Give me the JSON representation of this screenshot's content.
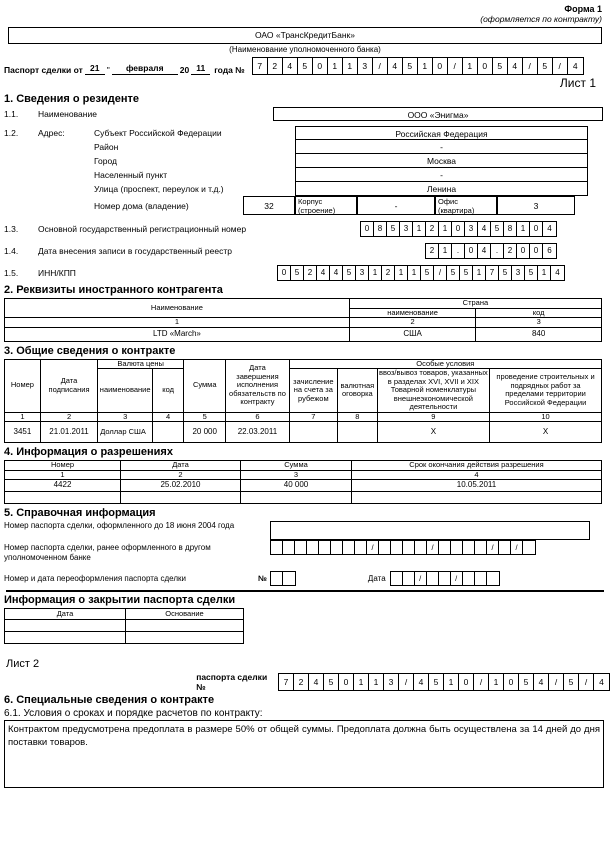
{
  "header": {
    "form_label": "Форма 1",
    "form_note": "(оформляется по контракту)",
    "bank_name": "ОАО «ТрансКредитБанк»",
    "bank_caption": "(Наименование уполномоченного банка)",
    "passport_prefix": "Паспорт сделки от",
    "day": "21",
    "quote": "\"",
    "month": "февраля",
    "year_prefix": "20",
    "year_suffix": "11",
    "year_word": "года №",
    "passport_number": "724501 13/4510/1054/5/4",
    "passport_cells": [
      "7",
      "2",
      "4",
      "5",
      "0",
      "1",
      "1",
      "3",
      "/",
      "4",
      "5",
      "1",
      "0",
      "/",
      "1",
      "0",
      "5",
      "4",
      "/",
      "5",
      "/",
      "4"
    ],
    "sheet_1": "Лист 1"
  },
  "section1": {
    "title": "1. Сведения о резиденте",
    "n11": "1.1.",
    "name_label": "Наименование",
    "name_value": "ООО «Энигма»",
    "n12": "1.2.",
    "address_label": "Адрес:",
    "address_rows": [
      {
        "label": "Субъект Российской Федерации",
        "value": "Российская Федерация"
      },
      {
        "label": "Район",
        "value": "-"
      },
      {
        "label": "Город",
        "value": "Москва"
      },
      {
        "label": "Населенный пункт",
        "value": "-"
      },
      {
        "label": "Улица (проспект, переулок и т.д.)",
        "value": "Ленина"
      }
    ],
    "house_label": "Номер дома (владение)",
    "house_value": "32",
    "building_label": "Корпус (строение)",
    "building_value": "-",
    "office_label": "Офис (квартира)",
    "office_value": "3",
    "n13": "1.3.",
    "ogrn_label": "Основной государственный регистрационный номер",
    "ogrn_cells": [
      "0",
      "8",
      "5",
      "3",
      "1",
      "2",
      "1",
      "0",
      "3",
      "4",
      "5",
      "8",
      "1",
      "0",
      "4"
    ],
    "n14": "1.4.",
    "reg_date_label": "Дата внесения записи в государственный реестр",
    "reg_date_cells": [
      "2",
      "1",
      ".",
      "0",
      "4",
      ".",
      "2",
      "0",
      "0",
      "6"
    ],
    "n15": "1.5.",
    "inn_label": "ИНН/КПП",
    "inn_cells": [
      "0",
      "5",
      "2",
      "4",
      "4",
      "5",
      "3",
      "1",
      "2",
      "1",
      "1",
      "5",
      "/",
      "5",
      "5",
      "1",
      "7",
      "5",
      "3",
      "5",
      "1",
      "4"
    ]
  },
  "section2": {
    "title": "2. Реквизиты иностранного контрагента",
    "headers": {
      "name": "Наименование",
      "country": "Страна",
      "country_name": "наименование",
      "country_code": "код"
    },
    "numbering": [
      "1",
      "2",
      "3"
    ],
    "row": {
      "name": "LTD «March»",
      "country_name": "США",
      "country_code": "840"
    }
  },
  "section3": {
    "title": "3. Общие сведения о контракте",
    "headers": {
      "number": "Номер",
      "sign_date": "Дата подписания",
      "price_currency": "Валюта цены",
      "currency_name": "наименование",
      "currency_code": "код",
      "sum": "Сумма",
      "end_date": "Дата завершения исполнения обязательств по контракту",
      "special_conditions": "Особые условия",
      "abroad_account": "зачисление на счета за рубежом",
      "currency_clause": "валютная оговорка",
      "goods_import": "ввоз/вывоз товаров, указанных в разделах XVI, XVII и XIX Товарной номенклатуры внешнеэкономической деятельности",
      "construction": "проведение строительных и подрядных работ за пределами территории Российской Федерации"
    },
    "numbering": [
      "1",
      "2",
      "3",
      "4",
      "5",
      "6",
      "7",
      "8",
      "9",
      "10"
    ],
    "row": {
      "number": "3451",
      "sign_date": "21.01.2011",
      "currency_name": "Доллар США",
      "currency_code": "",
      "sum": "20 000",
      "end_date": "22.03.2011",
      "abroad_account": "",
      "currency_clause": "",
      "goods_import": "X",
      "construction": "X"
    }
  },
  "section4": {
    "title": "4. Информация о разрешениях",
    "headers": {
      "number": "Номер",
      "date": "Дата",
      "sum": "Сумма",
      "expiry": "Срок окончания действия разрешения"
    },
    "numbering": [
      "1",
      "2",
      "3",
      "4"
    ],
    "rows": [
      {
        "number": "4422",
        "date": "25.02.2010",
        "sum": "40 000",
        "expiry": "10.05.2011"
      },
      {
        "number": "",
        "date": "",
        "sum": "",
        "expiry": ""
      }
    ]
  },
  "section5": {
    "title": "5. Справочная информация",
    "old_passport_label": "Номер паспорта сделки, оформленного до 18 июня 2004 года",
    "old_passport_cells": [
      "",
      "",
      "",
      "",
      "",
      "",
      "",
      "",
      "",
      "",
      "",
      "",
      "",
      "",
      "",
      "",
      "",
      "",
      "",
      ""
    ],
    "other_bank_label": "Номер паспорта сделки, ранее оформленного в другом уполномоченном банке",
    "other_bank_cells": [
      "",
      "",
      "",
      "",
      "",
      "",
      "",
      "",
      "/",
      "",
      "",
      "",
      "",
      "/",
      "",
      "",
      "",
      "",
      "/",
      "",
      "/",
      ""
    ],
    "reissue_label": "Номер и дата переоформления паспорта сделки",
    "reissue_no_label": "№",
    "reissue_no_cells": [
      "",
      ""
    ],
    "reissue_date_label": "Дата",
    "reissue_date_cells": [
      "",
      "",
      "/",
      "",
      "",
      "/",
      "",
      "",
      ""
    ]
  },
  "closing": {
    "title": "Информация о закрытии паспорта сделки",
    "headers": {
      "date": "Дата",
      "reason": "Основание"
    },
    "rows": [
      {
        "date": "",
        "reason": ""
      },
      {
        "date": "",
        "reason": ""
      }
    ]
  },
  "sheet2": {
    "label": "Лист 2",
    "passport_label": "паспорта сделки №",
    "passport_cells": [
      "7",
      "2",
      "4",
      "5",
      "0",
      "1",
      "1",
      "3",
      "/",
      "4",
      "5",
      "1",
      "0",
      "/",
      "1",
      "0",
      "5",
      "4",
      "/",
      "5",
      "/",
      "4"
    ]
  },
  "section6": {
    "title": "6. Специальные сведения о контракте",
    "sub_title": "6.1. Условия о сроках и порядке расчетов по контракту:",
    "text": "Контрактом предусмотрена предоплата в размере 50% от общей суммы. Предоплата должна быть осуществлена за 14 дней до дня поставки товаров."
  },
  "colors": {
    "ink": "#000000",
    "paper": "#ffffff"
  }
}
